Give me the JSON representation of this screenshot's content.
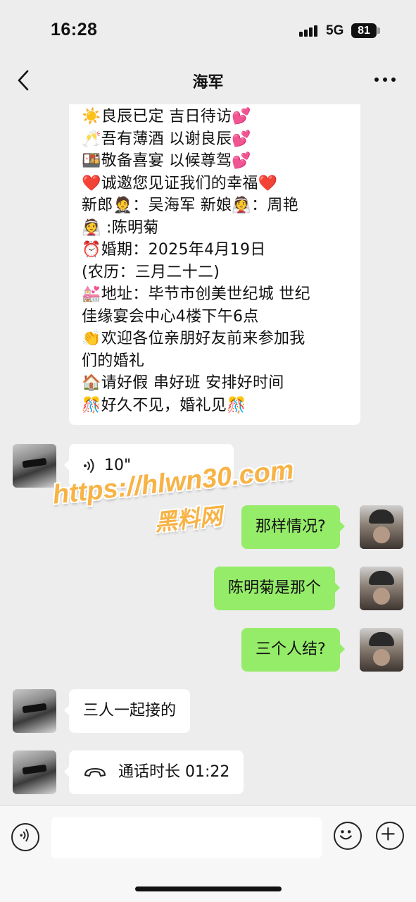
{
  "status_bar": {
    "time": "16:28",
    "network": "5G",
    "battery": "81"
  },
  "header": {
    "title": "海军"
  },
  "invitation": {
    "lines": [
      "☀️良辰已定 吉日待访💕",
      "🥂吾有薄酒 以谢良辰💕",
      "🍱敬备喜宴 以候尊驾💕",
      "❤️诚邀您见证我们的幸福❤️",
      "新郎🤵：吴海军  新娘👰：周艳",
      "👰 :陈明菊",
      "⏰婚期：2025年4月19日",
      "(农历：三月二十二)",
      "💒地址：毕节市创美世纪城  世纪",
      "佳缘宴会中心4楼下午6点",
      "👏欢迎各位亲朋好友前来参加我",
      "们的婚礼",
      "🏠请好假 串好班 安排好时间",
      "🎊好久不见，婚礼见🎊"
    ]
  },
  "messages": [
    {
      "side": "left",
      "type": "voice",
      "text": "10\""
    },
    {
      "side": "right",
      "type": "text",
      "text": "那样情况?"
    },
    {
      "side": "right",
      "type": "text",
      "text": "陈明菊是那个"
    },
    {
      "side": "right",
      "type": "text",
      "text": "三个人结?"
    },
    {
      "side": "left",
      "type": "text",
      "text": "三人一起接的"
    },
    {
      "side": "left",
      "type": "call",
      "text": "通话时长 01:22"
    }
  ],
  "watermark": {
    "url": "https://hlwn30.com",
    "name": "黑料网"
  },
  "input": {
    "value": ""
  },
  "colors": {
    "background": "#ededed",
    "outgoing_bubble": "#95ec69",
    "incoming_bubble": "#ffffff",
    "watermark": "#f7b345"
  },
  "icons": [
    "back-icon",
    "more-icon",
    "voice-icon",
    "phone-icon",
    "voice-input-icon",
    "emoji-icon",
    "plus-icon"
  ]
}
